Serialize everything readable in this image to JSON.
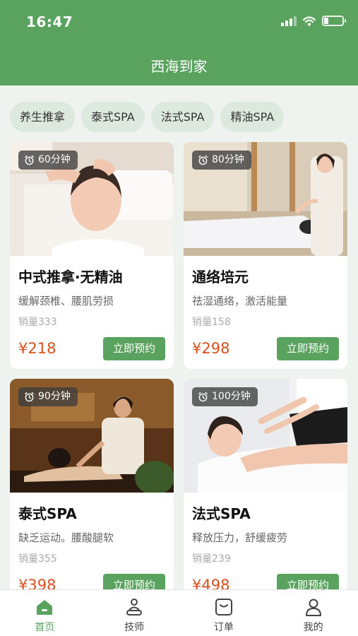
{
  "status_bar": {
    "time": "16:47"
  },
  "header": {
    "title": "西海到家"
  },
  "categories": [
    "养生推拿",
    "泰式SPA",
    "法式SPA",
    "精油SPA"
  ],
  "services": [
    {
      "duration": "60分钟",
      "title": "中式推拿·无精油",
      "desc": "缓解颈椎、腰肌劳损",
      "sales": "销量333",
      "price": "¥218",
      "button": "立即预约"
    },
    {
      "duration": "80分钟",
      "title": "通络培元",
      "desc": "祛湿通络，激活能量",
      "sales": "销量158",
      "price": "¥298",
      "button": "立即预约"
    },
    {
      "duration": "90分钟",
      "title": "泰式SPA",
      "desc": "缺乏运动。腰酸腿软",
      "sales": "销量355",
      "price": "¥398",
      "button": "立即预约"
    },
    {
      "duration": "100分钟",
      "title": "法式SPA",
      "desc": "释放压力，舒缓疲劳",
      "sales": "销量239",
      "price": "¥498",
      "button": "立即预约"
    }
  ],
  "tabbar": [
    {
      "label": "首页",
      "icon": "home-icon",
      "active": true
    },
    {
      "label": "技师",
      "icon": "technician-icon",
      "active": false
    },
    {
      "label": "订单",
      "icon": "order-icon",
      "active": false
    },
    {
      "label": "我的",
      "icon": "profile-icon",
      "active": false
    }
  ],
  "colors": {
    "primary": "#5aa35f",
    "price": "#d9501e",
    "background": "#eef3ef"
  }
}
